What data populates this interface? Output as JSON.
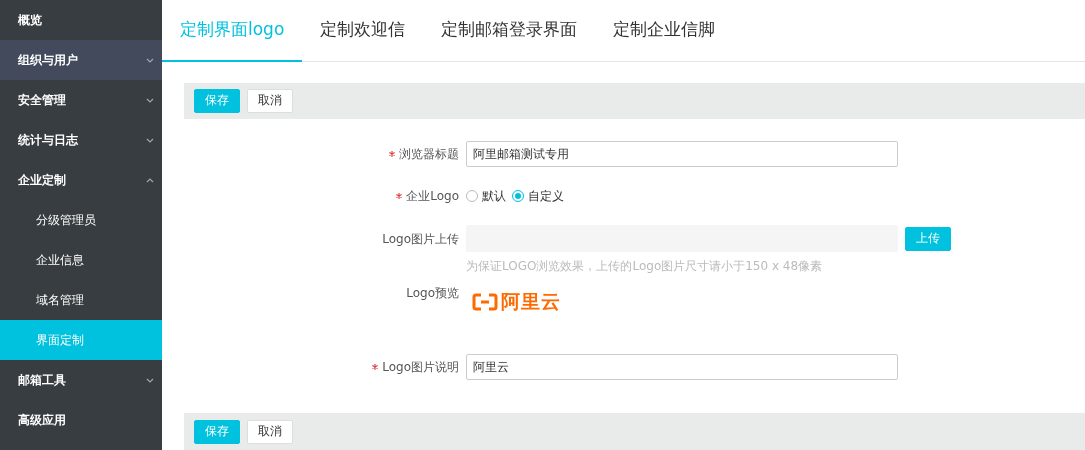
{
  "sidebar": {
    "items": [
      {
        "label": "概览",
        "selected": false,
        "highlighted": false
      },
      {
        "label": "组织与用户",
        "selected": false,
        "highlighted": true,
        "expanded": false
      },
      {
        "label": "安全管理",
        "selected": false,
        "highlighted": false,
        "expanded": false
      },
      {
        "label": "统计与日志",
        "selected": false,
        "highlighted": false,
        "expanded": false
      },
      {
        "label": "企业定制",
        "selected": false,
        "highlighted": false,
        "expanded": true,
        "children": [
          {
            "label": "分级管理员",
            "selected": false
          },
          {
            "label": "企业信息",
            "selected": false
          },
          {
            "label": "域名管理",
            "selected": false
          },
          {
            "label": "界面定制",
            "selected": true
          }
        ]
      },
      {
        "label": "邮箱工具",
        "selected": false,
        "highlighted": false,
        "expanded": false
      },
      {
        "label": "高级应用",
        "selected": false,
        "highlighted": false
      }
    ]
  },
  "tabs": [
    {
      "label": "定制界面logo",
      "selected": true
    },
    {
      "label": "定制欢迎信",
      "selected": false
    },
    {
      "label": "定制邮箱登录界面",
      "selected": false
    },
    {
      "label": "定制企业信脚",
      "selected": false
    }
  ],
  "top_toolbar": {
    "buttons": [
      {
        "label": "保存",
        "kind": "primary"
      },
      {
        "label": "取消",
        "kind": "default"
      }
    ]
  },
  "form": {
    "fields": [
      {
        "kind": "text",
        "label": "浏览器标题",
        "required": true,
        "value": "阿里邮箱测试专用"
      },
      {
        "kind": "radio",
        "label": "企业Logo",
        "required": true,
        "options": [
          {
            "label": "默认",
            "selected": false
          },
          {
            "label": "自定义",
            "selected": true
          }
        ]
      },
      {
        "kind": "upload",
        "label": "Logo图片上传",
        "required": false,
        "button": "上传",
        "hint": "为保证LOGO浏览效果，上传的Logo图片尺寸请小于150 x 48像素"
      },
      {
        "kind": "preview",
        "label": "Logo预览",
        "required": false,
        "logo_text": "阿里云"
      },
      {
        "kind": "text",
        "label": "Logo图片说明",
        "required": true,
        "value": "阿里云"
      }
    ]
  },
  "bottom_toolbar": {
    "buttons": [
      {
        "label": "保存",
        "kind": "primary"
      },
      {
        "label": "取消",
        "kind": "default"
      }
    ]
  }
}
